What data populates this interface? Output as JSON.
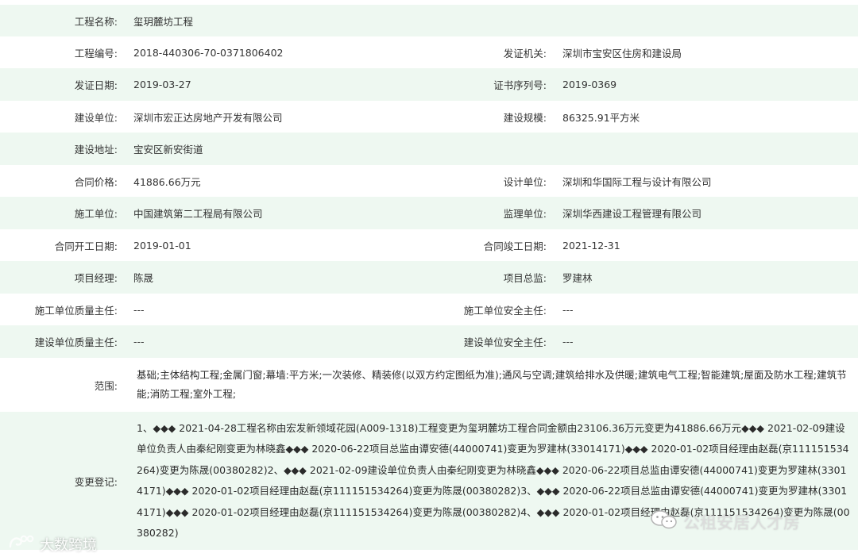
{
  "rows": [
    {
      "l1": "工程名称:",
      "v1": "玺玥麓坊工程",
      "l2": "",
      "v2": ""
    },
    {
      "l1": "工程编号:",
      "v1": "2018-440306-70-0371806402",
      "l2": "发证机关:",
      "v2": "深圳市宝安区住房和建设局"
    },
    {
      "l1": "发证日期:",
      "v1": "2019-03-27",
      "l2": "证书序列号:",
      "v2": "2019-0369"
    },
    {
      "l1": "建设单位:",
      "v1": "深圳市宏正达房地产开发有限公司",
      "l2": "建设规模:",
      "v2": "86325.91平方米"
    },
    {
      "l1": "建设地址:",
      "v1": "宝安区新安街道",
      "l2": "",
      "v2": ""
    },
    {
      "l1": "合同价格:",
      "v1": "41886.66万元",
      "l2": "设计单位:",
      "v2": "深圳和华国际工程与设计有限公司"
    },
    {
      "l1": "施工单位:",
      "v1": "中国建筑第二工程局有限公司",
      "l2": "监理单位:",
      "v2": "深圳华西建设工程管理有限公司"
    },
    {
      "l1": "合同开工日期:",
      "v1": "2019-01-01",
      "l2": "合同竣工日期:",
      "v2": "2021-12-31"
    },
    {
      "l1": "项目经理:",
      "v1": "陈晟",
      "l2": "项目总监:",
      "v2": "罗建林"
    },
    {
      "l1": "施工单位质量主任:",
      "v1": "---",
      "l2": "施工单位安全主任:",
      "v2": "---"
    },
    {
      "l1": "建设单位质量主任:",
      "v1": "---",
      "l2": "建设单位安全主任:",
      "v2": "---"
    }
  ],
  "scope": {
    "label": "范围:",
    "value": "基础;主体结构工程;金属门窗;幕墙:平方米;一次装修、精装修(以双方约定图纸为准);通风与空调;建筑给排水及供暖;建筑电气工程;智能建筑;屋面及防水工程;建筑节能;消防工程;室外工程;"
  },
  "changes": {
    "label": "变更登记:",
    "value": "1、◆◆◆ 2021-04-28工程名称由宏发新领域花园(A009-1318)工程变更为玺玥麓坊工程合同金额由23106.36万元变更为41886.66万元◆◆◆ 2021-02-09建设单位负责人由秦纪刚变更为林晓鑫◆◆◆ 2020-06-22项目总监由谭安德(44000741)变更为罗建林(33014171)◆◆◆ 2020-01-02项目经理由赵磊(京111151534264)变更为陈晟(00380282)2、◆◆◆ 2021-02-09建设单位负责人由秦纪刚变更为林晓鑫◆◆◆ 2020-06-22项目总监由谭安德(44000741)变更为罗建林(33014171)◆◆◆ 2020-01-02项目经理由赵磊(京111151534264)变更为陈晟(00380282)3、◆◆◆ 2020-06-22项目总监由谭安德(44000741)变更为罗建林(33014171)◆◆◆ 2020-01-02项目经理由赵磊(京111151534264)变更为陈晟(00380282)4、◆◆◆ 2020-01-02项目经理由赵磊(京111151534264)变更为陈晟(00380282)"
  },
  "watermark_left": "大数跨境",
  "watermark_right": "公租安居人才房"
}
